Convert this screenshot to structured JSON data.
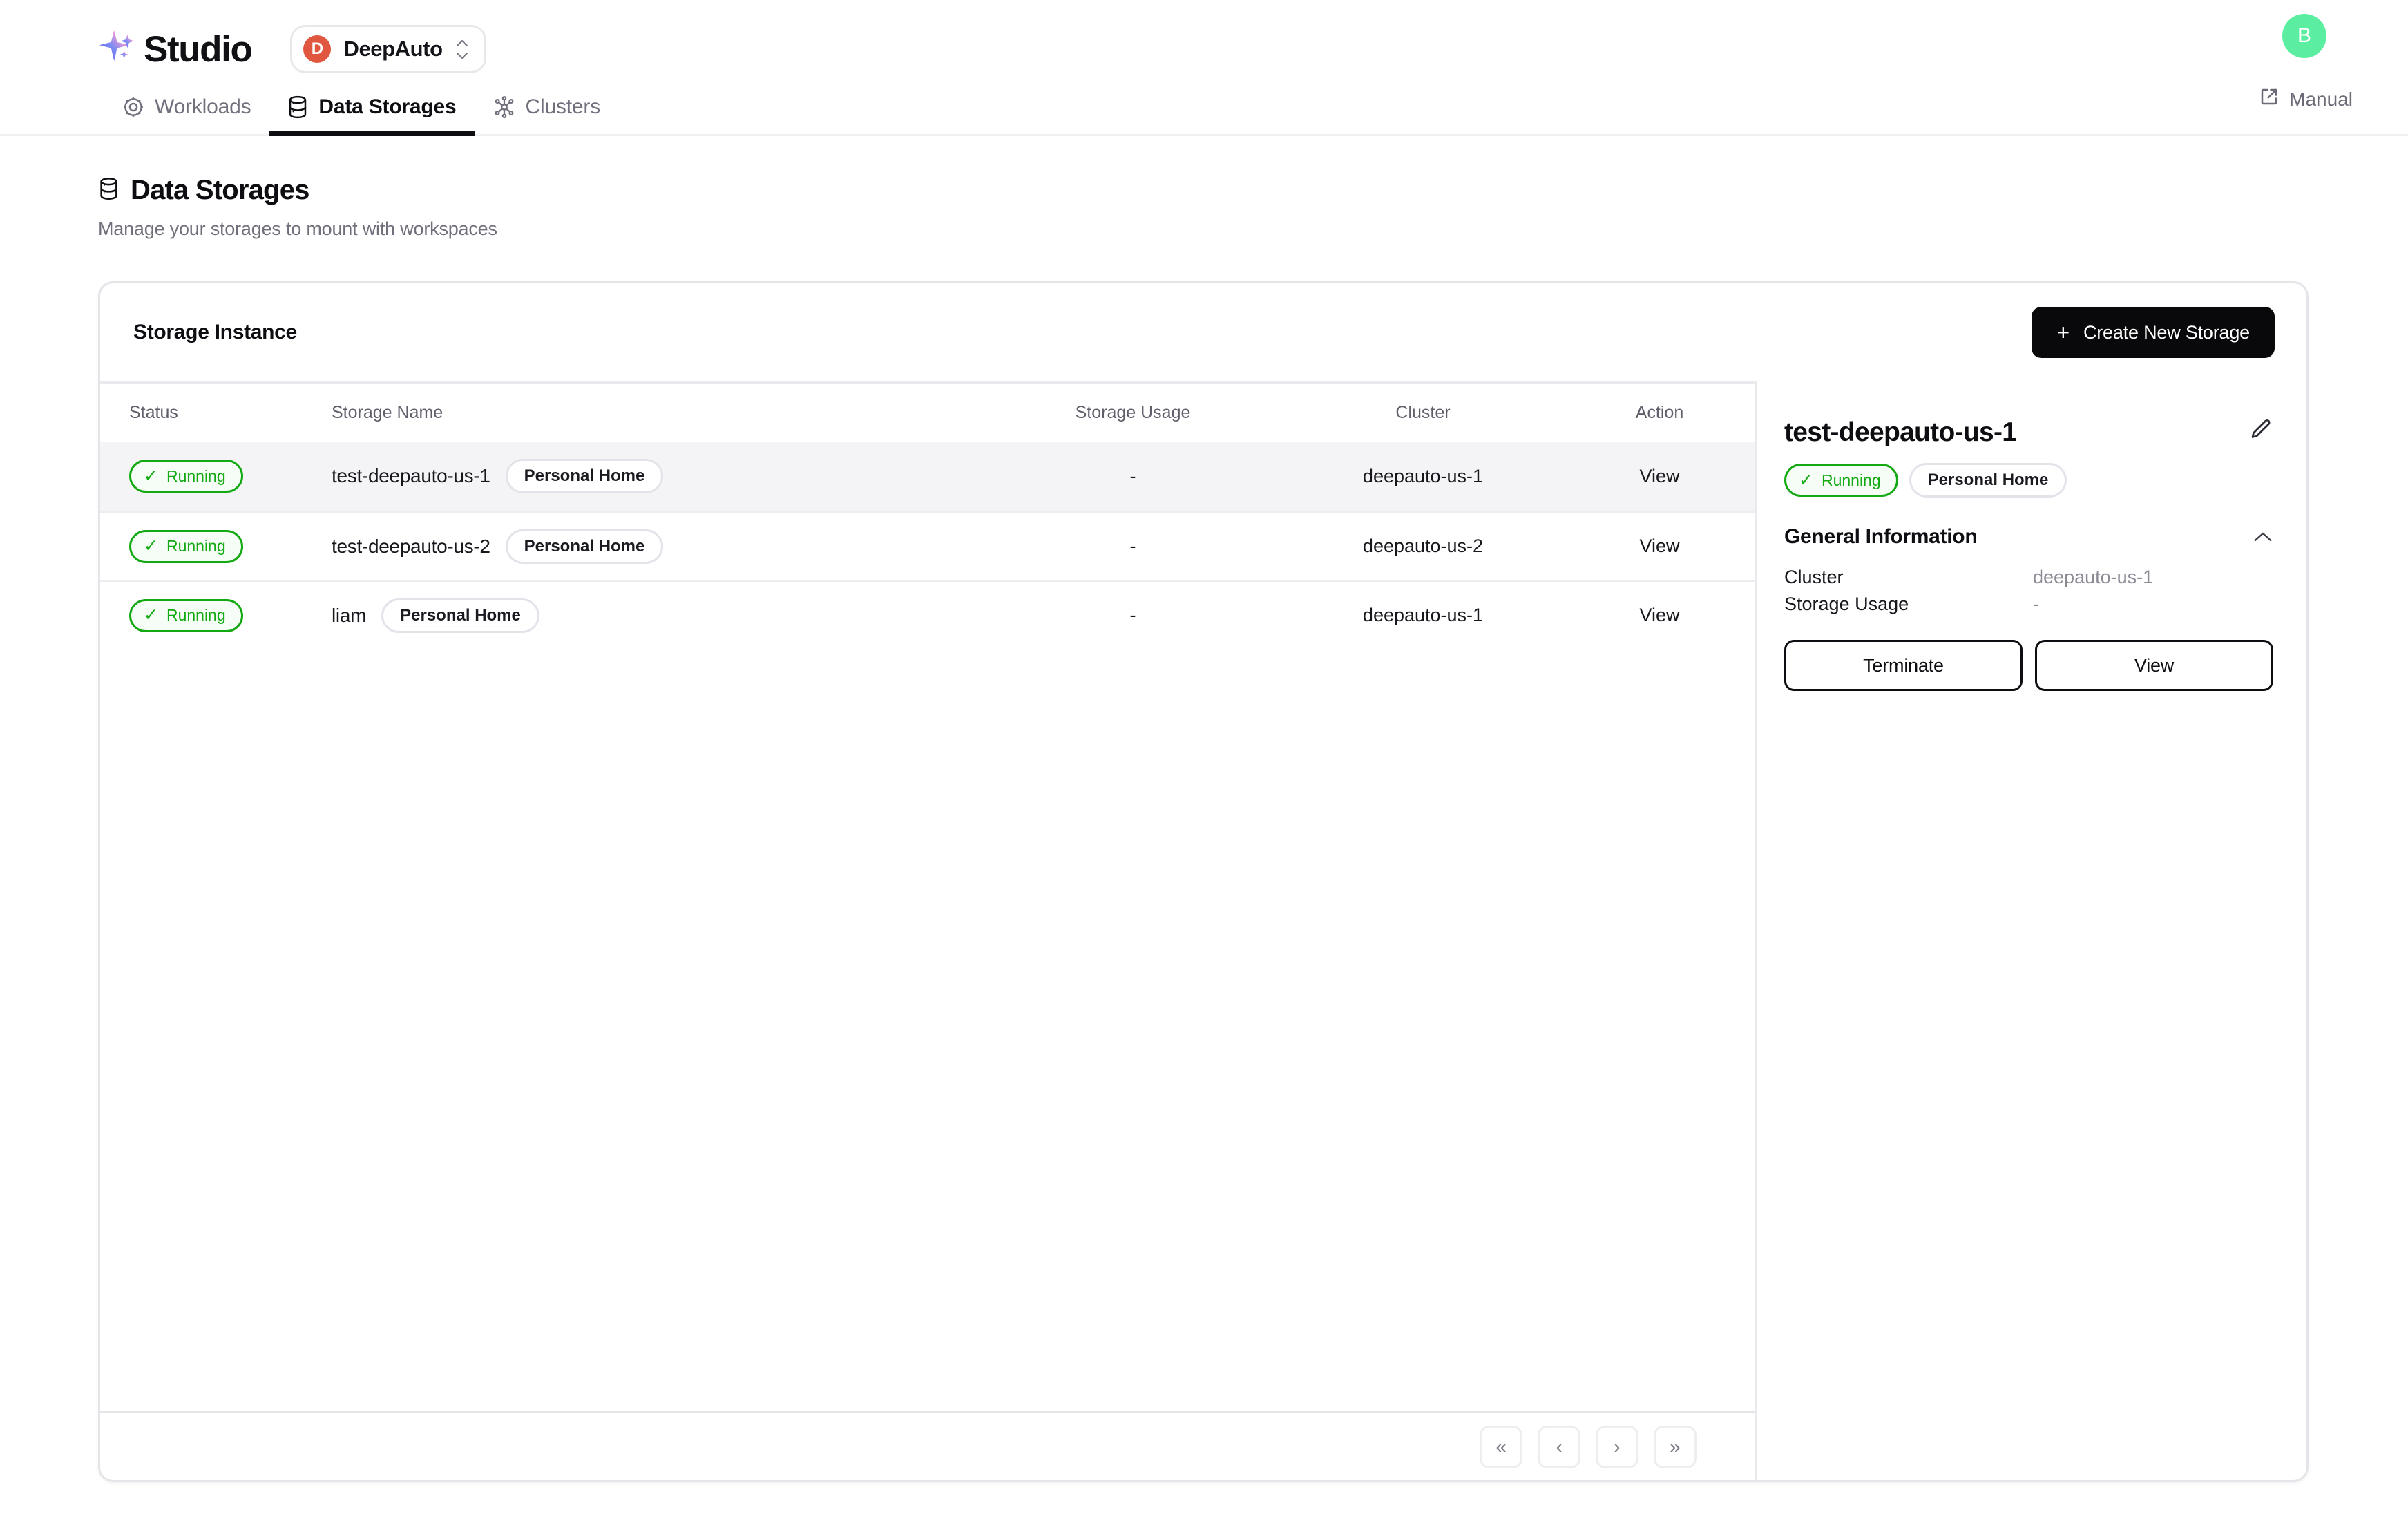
{
  "header": {
    "brand": "Studio",
    "brand_icon": "sparkle-icon",
    "org": {
      "initial": "D",
      "name": "DeepAuto",
      "caret_icon": "chevron-up-down-icon"
    },
    "manual": {
      "label": "Manual",
      "icon": "external-link-icon"
    },
    "user_avatar": {
      "initial": "B",
      "color": "#5ceea0"
    },
    "tabs": [
      {
        "label": "Workloads",
        "icon": "target-gear-icon",
        "active": false
      },
      {
        "label": "Data Storages",
        "icon": "database-icon",
        "active": true
      },
      {
        "label": "Clusters",
        "icon": "cluster-nodes-icon",
        "active": false
      }
    ]
  },
  "page": {
    "title": "Data Storages",
    "title_icon": "database-icon",
    "subtitle": "Manage your storages to mount with workspaces"
  },
  "card": {
    "title": "Storage Instance",
    "create_button": {
      "label": "Create New Storage",
      "icon": "plus-icon"
    },
    "table": {
      "columns": [
        "Status",
        "Storage Name",
        "Storage Usage",
        "Cluster",
        "Action"
      ],
      "rows": [
        {
          "status": "Running",
          "name": "test-deepauto-us-1",
          "tag": "Personal Home",
          "usage": "-",
          "cluster": "deepauto-us-1",
          "action": "View",
          "selected": true
        },
        {
          "status": "Running",
          "name": "test-deepauto-us-2",
          "tag": "Personal Home",
          "usage": "-",
          "cluster": "deepauto-us-2",
          "action": "View",
          "selected": false
        },
        {
          "status": "Running",
          "name": "liam",
          "tag": "Personal Home",
          "usage": "-",
          "cluster": "deepauto-us-1",
          "action": "View",
          "selected": false
        }
      ]
    },
    "pagination": {
      "first": "«",
      "prev": "‹",
      "next": "›",
      "last": "»"
    }
  },
  "detail": {
    "title": "test-deepauto-us-1",
    "edit_icon": "pencil-icon",
    "status_badge": "Running",
    "tag_badge": "Personal Home",
    "section": {
      "title": "General Information",
      "collapse_icon": "chevron-up-icon"
    },
    "fields": [
      {
        "key": "Cluster",
        "value": "deepauto-us-1"
      },
      {
        "key": "Storage Usage",
        "value": "-"
      }
    ],
    "actions": {
      "terminate": "Terminate",
      "view": "View"
    }
  },
  "colors": {
    "status_green": "#12a912",
    "accent_black": "#09090b",
    "org_red": "#e0563f",
    "avatar_green": "#5ceea0"
  }
}
